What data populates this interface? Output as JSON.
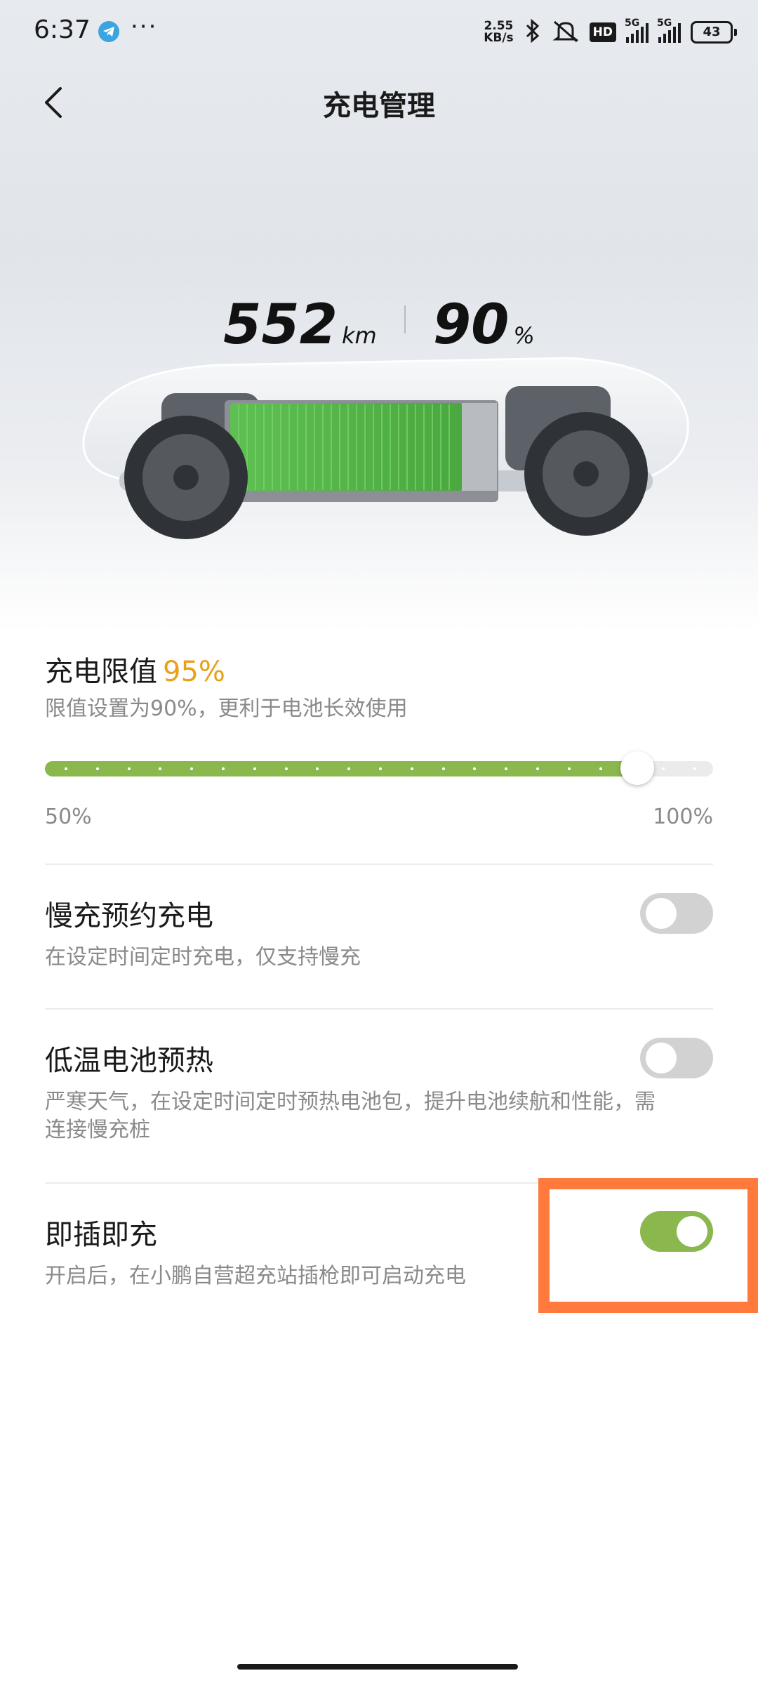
{
  "status_bar": {
    "time": "6:37",
    "more": "···",
    "speed_value": "2.55",
    "speed_unit": "KB/s",
    "hd": "HD",
    "net1": "5G",
    "net2": "5G",
    "battery": "43",
    "icons": [
      "telegram-icon",
      "bluetooth-icon",
      "mute-icon",
      "signal-icon",
      "battery-icon"
    ]
  },
  "header": {
    "title": "充电管理",
    "back_icon": "chevron-left-icon"
  },
  "stats": {
    "range": "552",
    "range_unit": "km",
    "charge": "90",
    "charge_unit": "%"
  },
  "charge_limit": {
    "title": "充电限值",
    "value": "95%",
    "desc": "限值设置为90%，更利于电池长效使用",
    "min_label": "50%",
    "max_label": "100%",
    "min": 50,
    "max": 100,
    "current": 95,
    "accent_color": "#8ab74e",
    "value_color": "#e8a11a"
  },
  "settings": [
    {
      "title": "慢充预约充电",
      "desc": "在设定时间定时充电，仅支持慢充",
      "enabled": false
    },
    {
      "title": "低温电池预热",
      "desc": "严寒天气，在设定时间定时预热电池包，提升电池续航和性能，需",
      "desc2": "连接慢充桩",
      "enabled": false
    },
    {
      "title": "即插即充",
      "desc": "开启后，在小鹏自营超充站插枪即可启动充电",
      "enabled": true
    }
  ],
  "highlight_color": "#ff7a3c"
}
